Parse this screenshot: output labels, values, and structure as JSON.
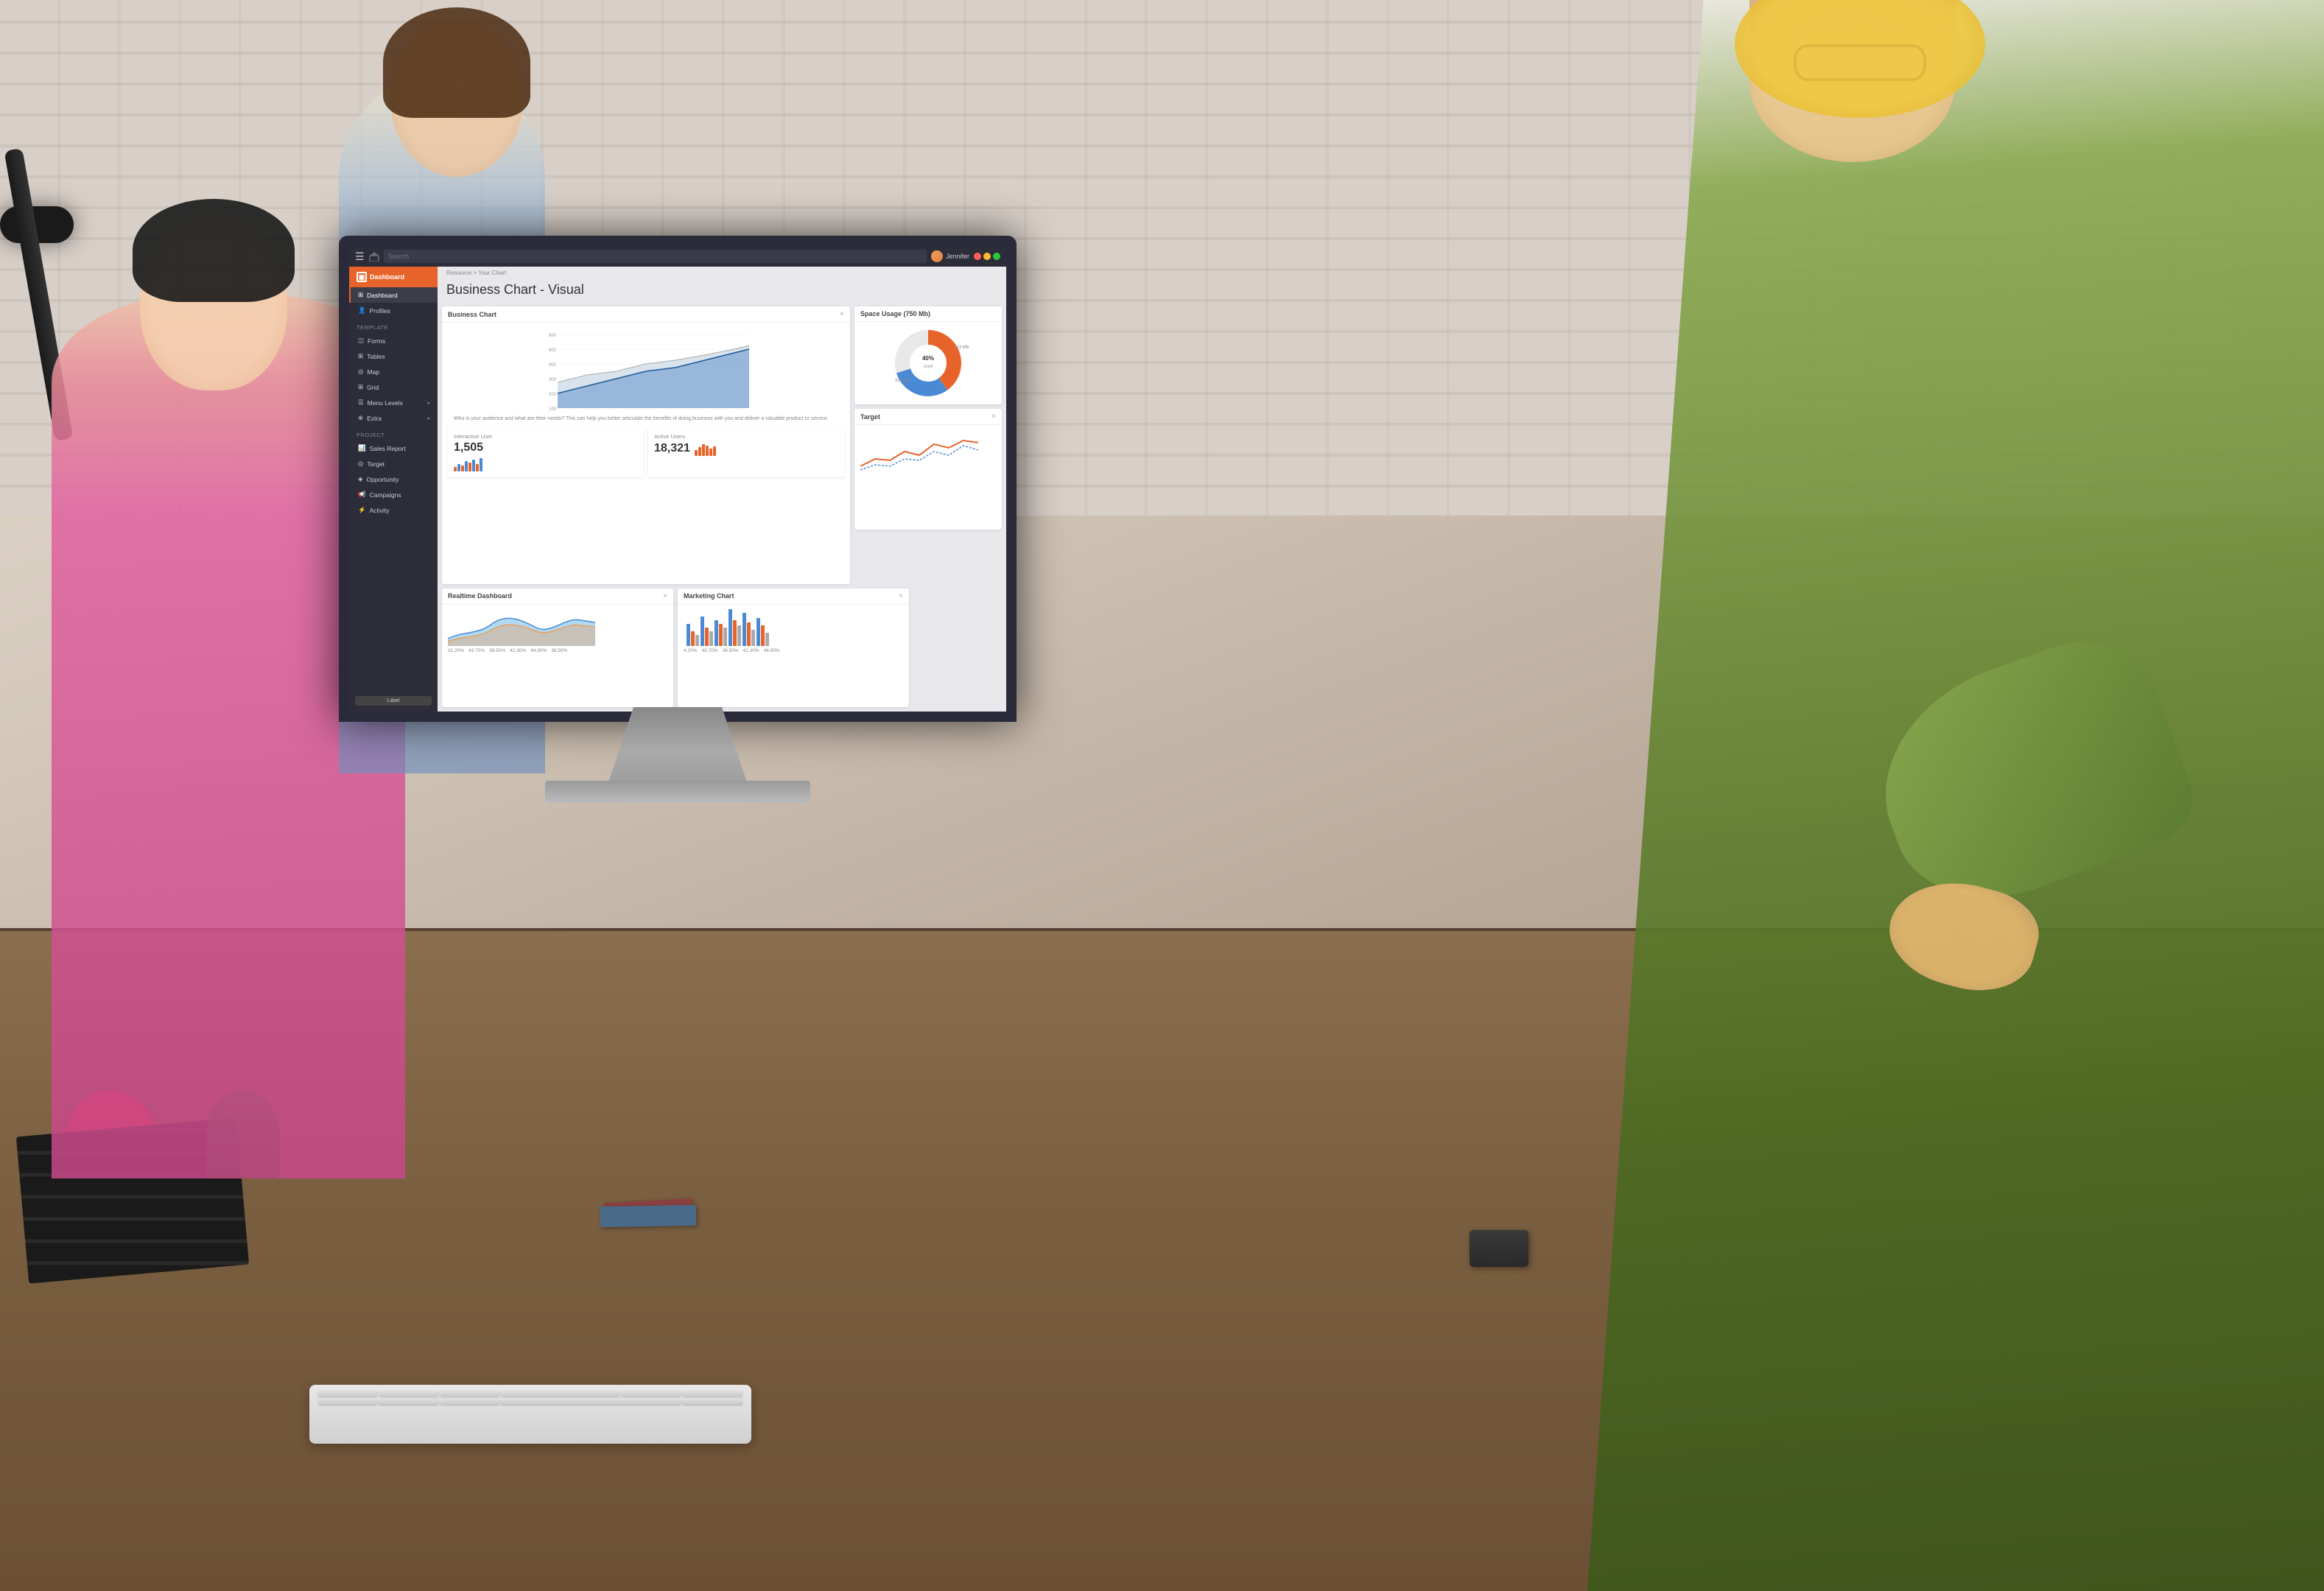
{
  "scene": {
    "bg_color": "#c8b8a2"
  },
  "app": {
    "top_bar": {
      "search_placeholder": "Search",
      "user_name": "Jennifer",
      "window_controls": [
        "red",
        "yellow",
        "green"
      ]
    },
    "sidebar": {
      "logo_text": "Dashboard",
      "active_indicator": true,
      "sections": [
        {
          "label": "",
          "items": [
            {
              "id": "dashboard",
              "label": "Dashboard",
              "active": true,
              "has_dot": true
            },
            {
              "id": "profiles",
              "label": "Profiles",
              "active": false,
              "has_dot": false
            }
          ]
        },
        {
          "label": "Template",
          "items": [
            {
              "id": "forms",
              "label": "Forms",
              "has_arrow": false
            },
            {
              "id": "tables",
              "label": "Tables",
              "has_arrow": false
            },
            {
              "id": "map",
              "label": "Map",
              "has_arrow": false
            },
            {
              "id": "grid",
              "label": "Grid",
              "has_arrow": false
            },
            {
              "id": "menu-levels",
              "label": "Menu Levels",
              "has_arrow": true
            },
            {
              "id": "extra",
              "label": "Extra",
              "has_arrow": true
            }
          ]
        },
        {
          "label": "Project",
          "items": [
            {
              "id": "sales-report",
              "label": "Sales Report",
              "has_arrow": false
            },
            {
              "id": "target",
              "label": "Target",
              "has_arrow": false
            },
            {
              "id": "opportunity",
              "label": "Opportunity",
              "has_arrow": false
            },
            {
              "id": "campaigns",
              "label": "Campaigns",
              "has_arrow": false
            },
            {
              "id": "activity",
              "label": "Activity",
              "has_arrow": false
            }
          ]
        }
      ],
      "bottom_label": "Label"
    },
    "breadcrumb": {
      "parent": "Resource",
      "separator": ">",
      "current": "Your Chart"
    },
    "page_title": "Business Chart - Visual",
    "cards": {
      "business_chart": {
        "title": "Business Chart",
        "close_btn": "×",
        "y_labels": [
          "800",
          "600",
          "400",
          "200",
          "100"
        ],
        "description": "Who is your audience and what are their needs? This can help you better articulate the benefits of doing business with you and deliver a valuable product or service."
      },
      "space_usage": {
        "title": "Space Usage (750 Mb)",
        "values": [
          "313 Mb",
          "315 Mb"
        ],
        "center_label": "40%"
      },
      "interactive_user": {
        "label": "Interactive User",
        "value": "1,505",
        "bars": [
          3,
          5,
          4,
          7,
          6,
          8,
          5,
          9,
          7,
          6
        ]
      },
      "active_users": {
        "label": "Active Users",
        "value": "18,321",
        "icon": "chart-bars"
      },
      "realtime_dashboard": {
        "title": "Realtime Dashboard",
        "close_btn": "×",
        "legend": [
          "31.20%",
          "43.70%",
          "38.50%",
          "42.30%",
          "44.90%",
          "38.50%"
        ]
      },
      "marketing_chart": {
        "title": "Marketing Chart",
        "close_btn": "×",
        "legend_labels": [
          "4.20%",
          "43.70%",
          "38.50%",
          "42.30%",
          "44.90%",
          "38.50%"
        ],
        "bar_groups": [
          {
            "a": 30,
            "b": 20,
            "c": 15
          },
          {
            "a": 40,
            "b": 25,
            "c": 20
          },
          {
            "a": 35,
            "b": 30,
            "c": 25
          },
          {
            "a": 50,
            "b": 35,
            "c": 28
          },
          {
            "a": 45,
            "b": 32,
            "c": 22
          },
          {
            "a": 38,
            "b": 28,
            "c": 18
          }
        ]
      },
      "target": {
        "title": "Target",
        "close_btn": "×"
      }
    }
  }
}
